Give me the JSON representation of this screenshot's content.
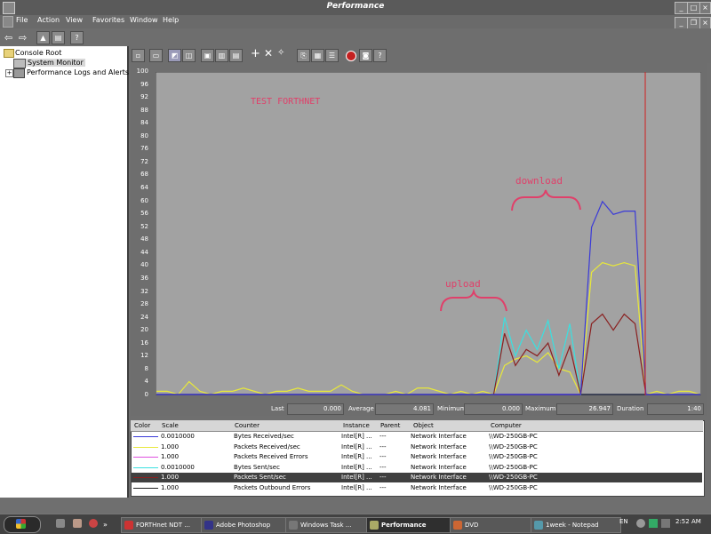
{
  "window": {
    "title": "Performance"
  },
  "menu": [
    "File",
    "Action",
    "View",
    "Favorites",
    "Window",
    "Help"
  ],
  "tree": {
    "root": "Console Root",
    "items": [
      "System Monitor",
      "Performance Logs and Alerts"
    ]
  },
  "graph": {
    "annotation_title": "TEST  FORTHNET",
    "annotation_download": "download",
    "annotation_upload": "upload"
  },
  "chart_data": {
    "type": "line",
    "ylim": [
      0,
      100
    ],
    "yticks": [
      "100",
      "96",
      "92",
      "88",
      "84",
      "80",
      "76",
      "72",
      "68",
      "64",
      "60",
      "56",
      "52",
      "48",
      "44",
      "40",
      "36",
      "32",
      "28",
      "24",
      "20",
      "16",
      "12",
      "8",
      "4",
      "0"
    ],
    "x": [
      0,
      2,
      4,
      6,
      8,
      10,
      12,
      14,
      16,
      18,
      20,
      22,
      24,
      26,
      28,
      30,
      32,
      34,
      36,
      38,
      40,
      42,
      44,
      46,
      48,
      50,
      52,
      54,
      56,
      58,
      60,
      62,
      64,
      66,
      68,
      70,
      72,
      74,
      76,
      78,
      80,
      82,
      84,
      86,
      88,
      90,
      92,
      94,
      96,
      98,
      100
    ],
    "series": [
      {
        "name": "Bytes Received/sec",
        "color": "#3a3ad8",
        "values": [
          0,
          0,
          0,
          0,
          0,
          0,
          0,
          0,
          0,
          0,
          0,
          0,
          0,
          0,
          0,
          0,
          0,
          0,
          0,
          0,
          0,
          0,
          0,
          0,
          0,
          0,
          0,
          0,
          0,
          0,
          0,
          0,
          0,
          0,
          0,
          0,
          0,
          0,
          0,
          0,
          0,
          0,
          0,
          0,
          0,
          0,
          0,
          0,
          0,
          0,
          0
        ]
      },
      {
        "name": "Packets Received/sec",
        "color": "#e8e83a",
        "values": [
          1,
          1,
          0,
          4,
          1,
          0,
          1,
          1,
          2,
          1,
          0,
          1,
          1,
          2,
          1,
          1,
          1,
          3,
          1,
          0,
          0,
          0,
          1,
          0,
          2,
          2,
          1,
          0,
          1,
          0,
          1,
          0,
          9,
          11,
          12,
          10,
          13,
          8,
          7,
          0,
          38,
          41,
          40,
          41,
          40,
          0,
          1,
          0,
          1,
          1,
          0
        ]
      },
      {
        "name": "Packets Received Errors",
        "color": "#e050e0",
        "values": [
          0,
          0,
          0,
          0,
          0,
          0,
          0,
          0,
          0,
          0,
          0,
          0,
          0,
          0,
          0,
          0,
          0,
          0,
          0,
          0,
          0,
          0,
          0,
          0,
          0,
          0,
          0,
          0,
          0,
          0,
          0,
          0,
          0,
          0,
          0,
          0,
          0,
          0,
          0,
          0,
          0,
          0,
          0,
          0,
          0,
          0,
          0,
          0,
          0,
          0,
          0
        ]
      },
      {
        "name": "Bytes Sent/sec",
        "color": "#3ae0e0",
        "values": [
          0,
          0,
          0,
          0,
          0,
          0,
          0,
          0,
          0,
          0,
          0,
          0,
          0,
          0,
          0,
          0,
          0,
          0,
          0,
          0,
          0,
          0,
          0,
          0,
          0,
          0,
          0,
          0,
          0,
          0,
          0,
          0,
          24,
          12,
          20,
          14,
          23,
          8,
          22,
          0,
          0,
          0,
          0,
          0,
          0,
          0,
          0,
          0,
          0,
          0,
          0
        ]
      },
      {
        "name": "Packets Sent/sec",
        "color": "#8a2020",
        "values": [
          0,
          0,
          0,
          0,
          0,
          0,
          0,
          0,
          0,
          0,
          0,
          0,
          0,
          0,
          0,
          0,
          0,
          0,
          0,
          0,
          0,
          0,
          0,
          0,
          0,
          0,
          0,
          0,
          0,
          0,
          0,
          0,
          19,
          9,
          14,
          12,
          16,
          6,
          15,
          0,
          22,
          25,
          20,
          25,
          22,
          0,
          0,
          0,
          0,
          0,
          0
        ]
      },
      {
        "name": "Packets Outbound Errors",
        "color": "#202020",
        "values": [
          0,
          0,
          0,
          0,
          0,
          0,
          0,
          0,
          0,
          0,
          0,
          0,
          0,
          0,
          0,
          0,
          0,
          0,
          0,
          0,
          0,
          0,
          0,
          0,
          0,
          0,
          0,
          0,
          0,
          0,
          0,
          0,
          0,
          0,
          0,
          0,
          0,
          0,
          0,
          0,
          0,
          0,
          0,
          0,
          0,
          0,
          0,
          0,
          0,
          0,
          0
        ]
      },
      {
        "name": "Bytes Received/sec (scaled)",
        "color": "#3a3ad8",
        "values": [
          0,
          0,
          0,
          0,
          0,
          0,
          0,
          0,
          0,
          0,
          0,
          0,
          0,
          0,
          0,
          0,
          0,
          0,
          0,
          0,
          0,
          0,
          0,
          0,
          0,
          0,
          0,
          0,
          0,
          0,
          0,
          0,
          0,
          0,
          0,
          0,
          0,
          0,
          0,
          0,
          52,
          60,
          56,
          57,
          57,
          0,
          0,
          0,
          0,
          0,
          0
        ]
      }
    ]
  },
  "stats": {
    "last_label": "Last",
    "last_value": "0.000",
    "average_label": "Average",
    "average_value": "4.081",
    "minimum_label": "Minimum",
    "minimum_value": "0.000",
    "maximum_label": "Maximum",
    "maximum_value": "26.947",
    "duration_label": "Duration",
    "duration_value": "1:40"
  },
  "legend": {
    "headers": [
      "Color",
      "Scale",
      "Counter",
      "Instance",
      "Parent",
      "Object",
      "Computer"
    ],
    "rows": [
      {
        "color": "#3a3ad8",
        "scale": "0.0010000",
        "counter": "Bytes Received/sec",
        "instance": "Intel[R] ...",
        "parent": "---",
        "object": "Network Interface",
        "computer": "\\\\WD-250GB-PC"
      },
      {
        "color": "#e8e83a",
        "scale": "1.000",
        "counter": "Packets Received/sec",
        "instance": "Intel[R] ...",
        "parent": "---",
        "object": "Network Interface",
        "computer": "\\\\WD-250GB-PC"
      },
      {
        "color": "#e050e0",
        "scale": "1.000",
        "counter": "Packets Received Errors",
        "instance": "Intel[R] ...",
        "parent": "---",
        "object": "Network Interface",
        "computer": "\\\\WD-250GB-PC"
      },
      {
        "color": "#3ae0e0",
        "scale": "0.0010000",
        "counter": "Bytes Sent/sec",
        "instance": "Intel[R] ...",
        "parent": "---",
        "object": "Network Interface",
        "computer": "\\\\WD-250GB-PC"
      },
      {
        "color": "#8a2020",
        "scale": "1.000",
        "counter": "Packets Sent/sec",
        "instance": "Intel[R] ...",
        "parent": "---",
        "object": "Network Interface",
        "computer": "\\\\WD-250GB-PC"
      },
      {
        "color": "#202020",
        "scale": "1.000",
        "counter": "Packets Outbound Errors",
        "instance": "Intel[R] ...",
        "parent": "---",
        "object": "Network Interface",
        "computer": "\\\\WD-250GB-PC"
      }
    ]
  },
  "taskbar": {
    "tasks": [
      {
        "label": "FORTHnet NDT ...",
        "icon_color": "#c33"
      },
      {
        "label": "Adobe Photoshop",
        "icon_color": "#338"
      },
      {
        "label": "Windows Task ...",
        "icon_color": "#777"
      },
      {
        "label": "Performance",
        "icon_color": "#aa6"
      },
      {
        "label": "DVD",
        "icon_color": "#c63"
      },
      {
        "label": "1week - Notepad",
        "icon_color": "#59a"
      }
    ],
    "lang": "EN",
    "clock": "2:52 AM"
  }
}
